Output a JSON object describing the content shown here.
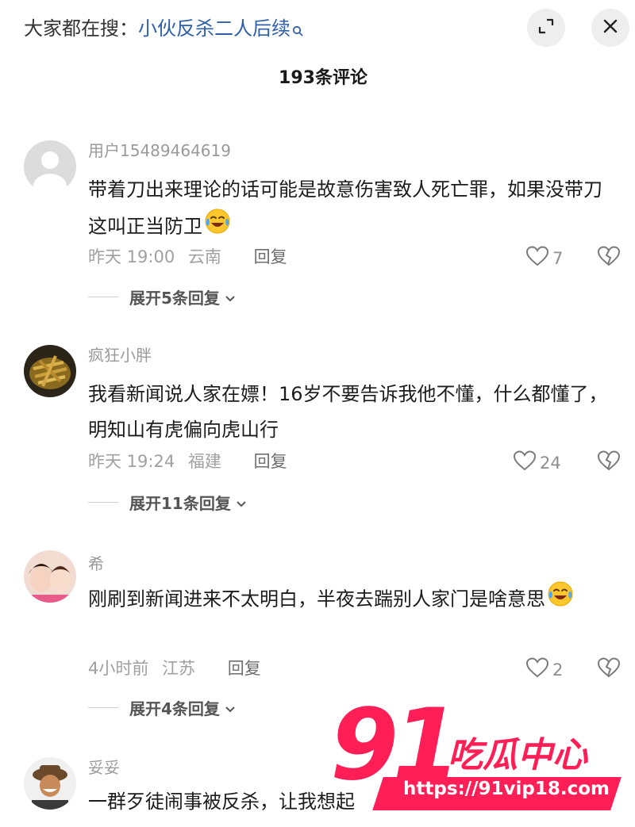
{
  "header": {
    "search_prefix": "大家都在搜：",
    "search_term": "小伙反杀二人后续",
    "comment_count": "193条评论",
    "icons": {
      "expand": "expand-icon",
      "close": "close-icon",
      "search": "search-icon"
    }
  },
  "comments": [
    {
      "username": "用户15489464619",
      "text": "带着刀出来理论的话可能是故意伤害致人死亡罪，如果没带刀这叫正当防卫",
      "emoji": "crying-laughing-emoji",
      "time": "昨天 19:00",
      "location": "云南",
      "reply_label": "回复",
      "likes": "7",
      "expand_label": "展开5条回复"
    },
    {
      "username": "疯狂小胖",
      "text": "我看新闻说人家在嫖！16岁不要告诉我他不懂，什么都懂了，明知山有虎偏向虎山行",
      "time": "昨天 19:24",
      "location": "福建",
      "reply_label": "回复",
      "likes": "24",
      "expand_label": "展开11条回复"
    },
    {
      "username": "希",
      "text": "刚刷到新闻进来不太明白，半夜去踹别人家门是啥意思",
      "emoji": "crying-laughing-emoji",
      "time": "4小时前",
      "location": "江苏",
      "reply_label": "回复",
      "likes": "2",
      "expand_label": "展开4条回复"
    },
    {
      "username": "妥妥",
      "text": "一群歹徒闹事被反杀，让我想起"
    }
  ],
  "watermark": {
    "number": "91",
    "brand": "吃瓜中心",
    "url": "https://91vip18.com"
  },
  "colors": {
    "accent_link": "#2f5fa8",
    "watermark": "#ff1f56",
    "muted_text": "#9a9a9a"
  }
}
